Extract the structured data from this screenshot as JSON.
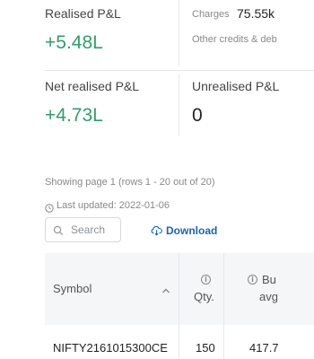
{
  "pnl": {
    "realised_label": "Realised P&L",
    "realised_value": "+5.48L",
    "charges_label": "Charges",
    "charges_value": "75.55k",
    "other_credits_label": "Other credits & deb",
    "net_realised_label": "Net realised P&L",
    "net_realised_value": "+4.73L",
    "unrealised_label": "Unrealised P&L",
    "unrealised_value": "0"
  },
  "meta": {
    "paging": "Showing page 1 (rows 1 - 20 out of 20)",
    "last_updated": "Last updated: 2022-01-06"
  },
  "toolbar": {
    "search_placeholder": "Search",
    "download_label": "Download"
  },
  "table": {
    "columns": [
      {
        "label": "Symbol"
      },
      {
        "label": "Qty."
      },
      {
        "label_top": "Bu",
        "label_bottom": "avg"
      }
    ],
    "rows": [
      {
        "symbol": "NIFTY2161015300CE",
        "qty": "150",
        "buy_avg": "417.7"
      }
    ]
  },
  "colors": {
    "positive": "#2f9e6b",
    "link": "#1565c0"
  }
}
